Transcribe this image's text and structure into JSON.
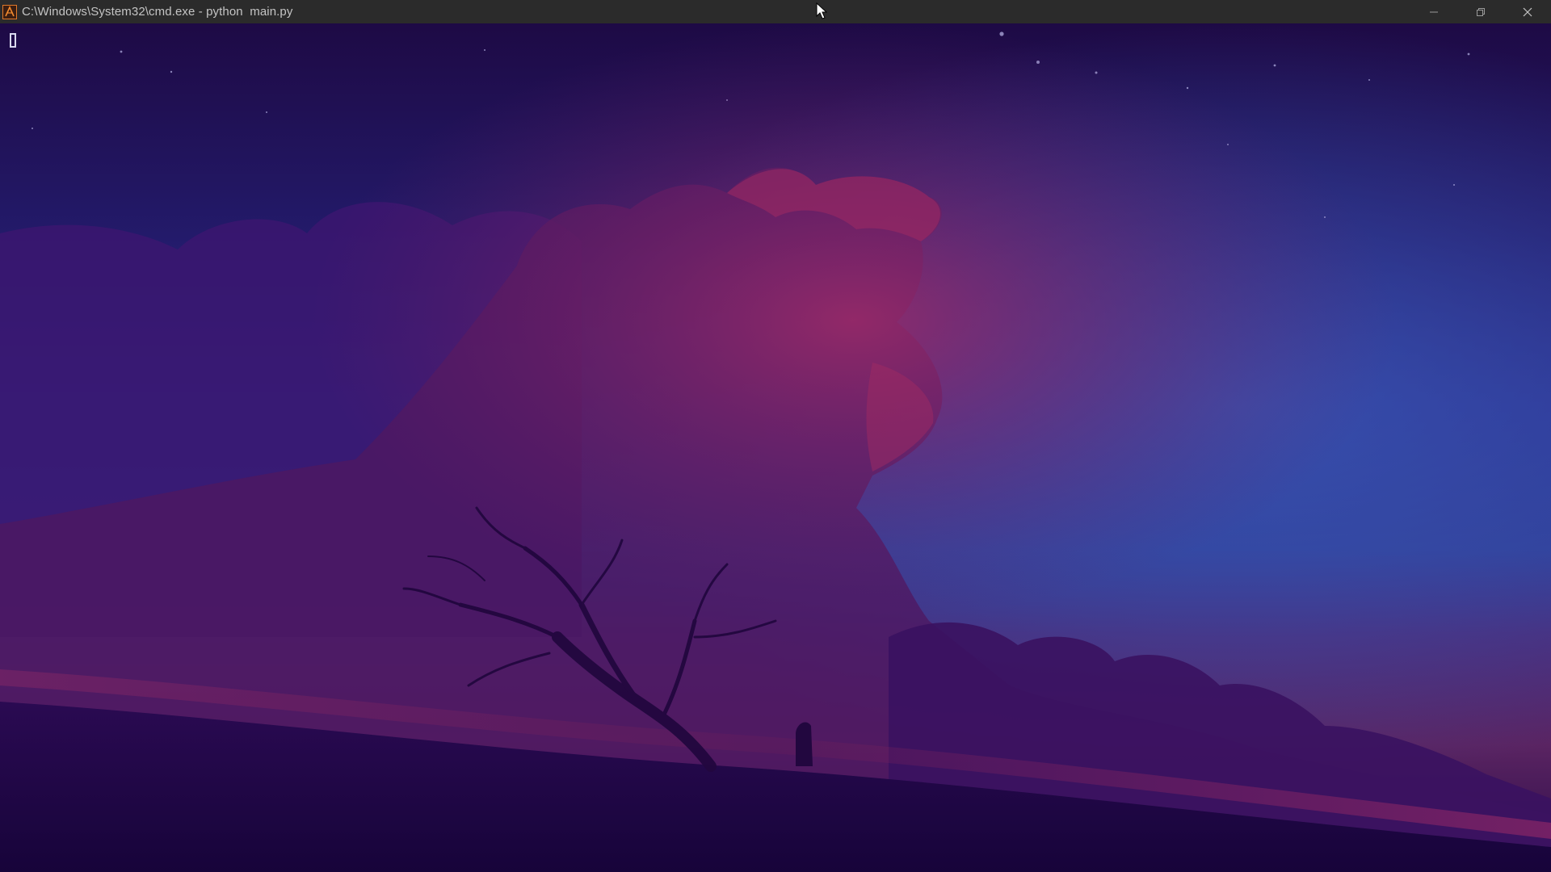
{
  "window": {
    "title": "C:\\Windows\\System32\\cmd.exe - python  main.py",
    "app_icon": "terminal-app-icon",
    "controls": {
      "minimize": "minimize-icon",
      "restore": "restore-icon",
      "close": "close-icon"
    }
  },
  "terminal": {
    "output": "",
    "cursor": "block-cursor"
  },
  "colors": {
    "titlebar": "#2b2b2b",
    "title_text": "#c4c4c4",
    "sky_top": "#1e0a45",
    "sky_mid": "#2c2a8a",
    "cloud": "#8a2060",
    "ground": "#1a053d"
  }
}
